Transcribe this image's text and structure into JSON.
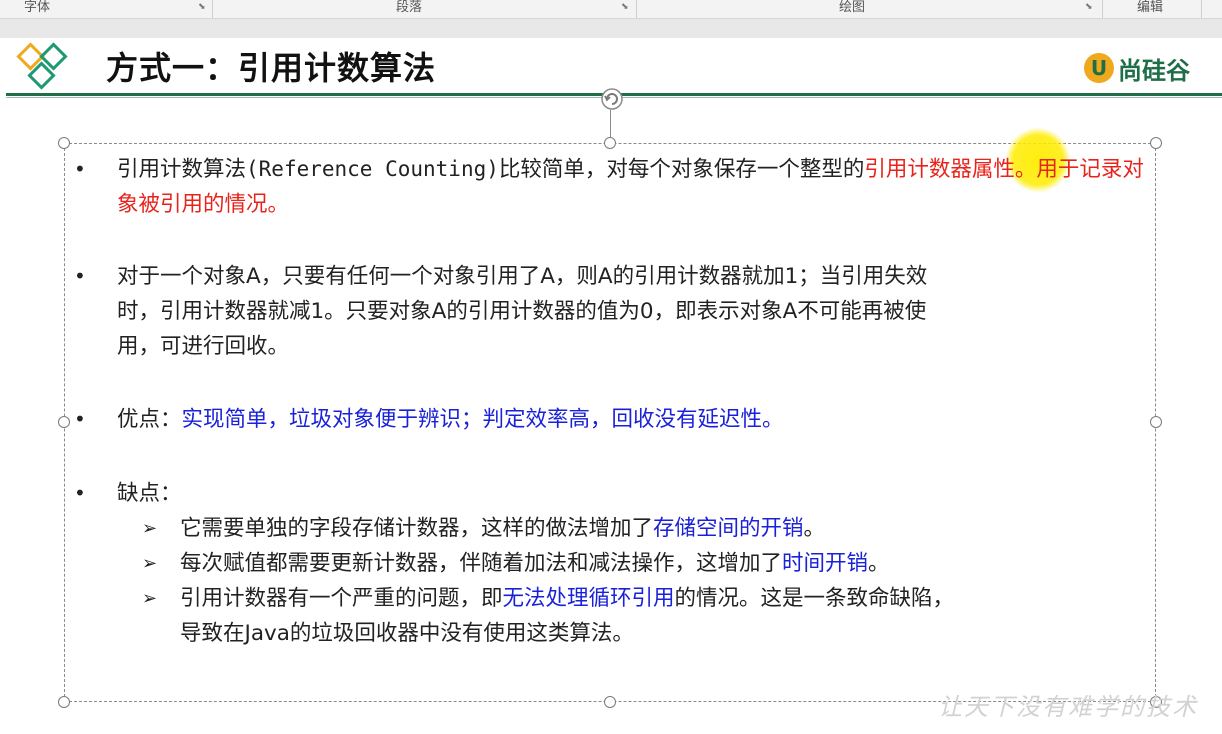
{
  "ribbon": {
    "groups": [
      "字体",
      "段落",
      "绘图",
      "编辑"
    ]
  },
  "slide": {
    "title": "方式一：引用计数算法",
    "brand": "尚硅谷",
    "brand_mark": "U",
    "watermark": "让天下没有难学的技术",
    "bullets": [
      {
        "parts": [
          "引用计数算法",
          "(Reference Counting)",
          "比较简单，对每个对象保存一个整型的",
          "引用计数器属性。用于记录对象被引用的情况。"
        ]
      },
      {
        "lines": [
          "对于一个对象A，只要有任何一个对象引用了A，则A的引用计数器就加1；当引用失效",
          "时，引用计数器就减1。只要对象A的引用计数器的值为0，即表示对象A不可能再被使",
          "用，可进行回收。"
        ]
      },
      {
        "label": "优点：",
        "text": "实现简单，垃圾对象便于辨识；判定效率高，回收没有延迟性。"
      },
      {
        "label": "缺点：",
        "subs": [
          {
            "pre": "它需要单独的字段存储计数器，这样的做法增加了",
            "hl": "存储空间的开销",
            "post": "。"
          },
          {
            "pre": "每次赋值都需要更新计数器，伴随着加法和减法操作，这增加了",
            "hl": "时间开销",
            "post": "。"
          },
          {
            "pre": "引用计数器有一个严重的问题，即",
            "hl": "无法处理循环引用",
            "post": "的情况。这是一条致命缺陷，",
            "line2": "导致在Java的垃圾回收器中没有使用这类算法。"
          }
        ]
      }
    ]
  },
  "icons": {
    "bullet": "•",
    "arrow": "➢"
  },
  "colors": {
    "accent_green": "#1e6e47",
    "red": "#e8231b",
    "blue": "#1a22d8"
  }
}
